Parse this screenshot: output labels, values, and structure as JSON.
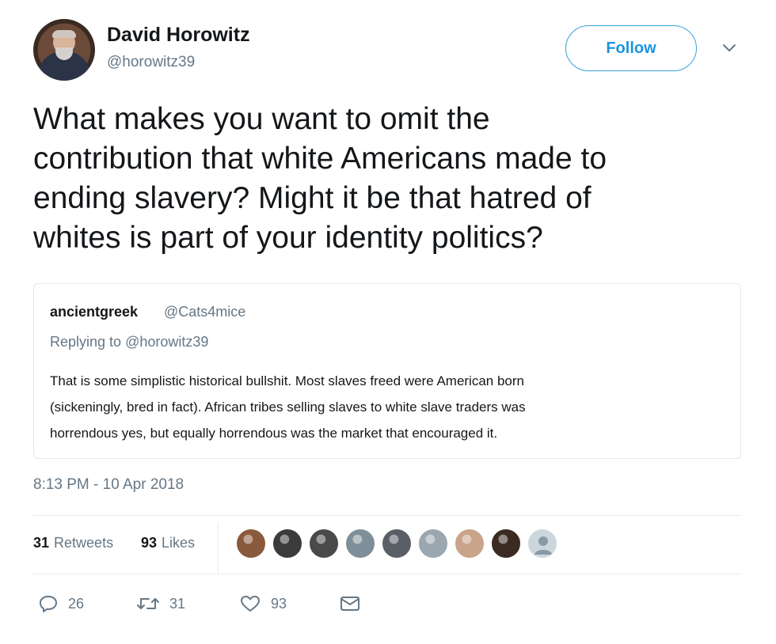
{
  "author": {
    "name": "David Horowitz",
    "handle": "@horowitz39"
  },
  "follow_label": "Follow",
  "tweet": {
    "lines": [
      "What makes you want to omit the",
      "contribution that white Americans made to",
      "ending slavery? Might it be that hatred of",
      "whites is part of your identity politics?"
    ]
  },
  "quoted": {
    "name": "ancientgreek",
    "handle": "@Cats4mice",
    "replying_prefix": "Replying to",
    "replying_handle": "@horowitz39",
    "lines": [
      "That is some simplistic historical bullshit. Most slaves freed were American born",
      "(sickeningly, bred in fact). African tribes selling slaves to white slave traders was",
      "horrendous yes, but equally horrendous was the market that encouraged it."
    ]
  },
  "timestamp": "8:13 PM - 10 Apr 2018",
  "stats": {
    "retweets_count": "31",
    "retweets_label": "Retweets",
    "likes_count": "93",
    "likes_label": "Likes"
  },
  "liker_avatar_colors": [
    "#8a5a3c",
    "#3b3b3b",
    "#4a4a4a",
    "#7f8f99",
    "#5a5f66",
    "#9aa7b0",
    "#c9a48a",
    "#3a2a22",
    "#ccd6dd"
  ],
  "actions": {
    "replies": "26",
    "retweets": "31",
    "likes": "93"
  },
  "colors": {
    "accent": "#1b95e0",
    "muted": "#657786",
    "border": "#e1e8ed"
  },
  "icons": {
    "reply": "reply-icon",
    "retweet": "retweet-icon",
    "like": "heart-icon",
    "message": "envelope-icon",
    "caret": "chevron-down-icon"
  }
}
